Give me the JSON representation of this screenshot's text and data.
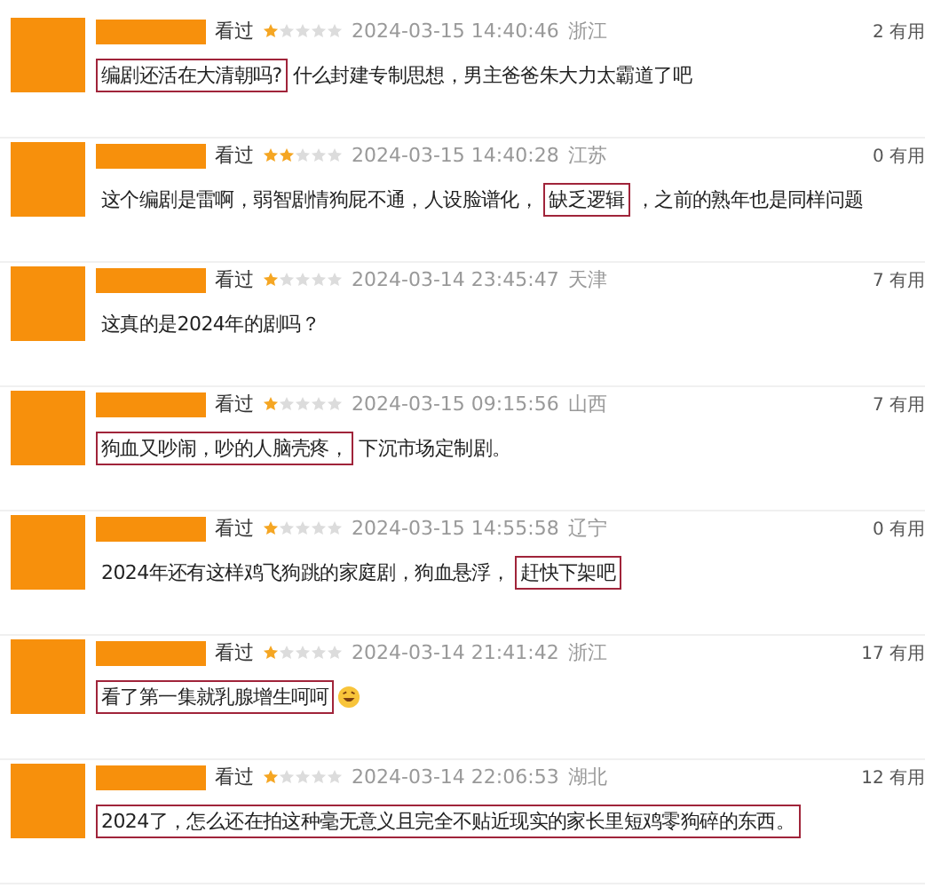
{
  "comments": [
    {
      "watched": "看过",
      "stars": 1,
      "time": "2024-03-15 14:40:46",
      "location": "浙江",
      "useful": "2 有用",
      "emoji": false,
      "text": [
        {
          "text": "编剧还活在大清朝吗?",
          "highlighted": true
        },
        {
          "text": "什么封建专制思想，男主爸爸朱大力太霸道了吧",
          "highlighted": false
        }
      ]
    },
    {
      "watched": "看过",
      "stars": 2,
      "time": "2024-03-15 14:40:28",
      "location": "江苏",
      "useful": "0 有用",
      "emoji": false,
      "text": [
        {
          "text": "这个编剧是雷啊，弱智剧情狗屁不通，人设脸谱化，",
          "highlighted": false
        },
        {
          "text": "缺乏逻辑",
          "highlighted": true
        },
        {
          "text": "，之前的熟年也是同样问题",
          "highlighted": false
        }
      ]
    },
    {
      "watched": "看过",
      "stars": 1,
      "time": "2024-03-14 23:45:47",
      "location": "天津",
      "useful": "7 有用",
      "emoji": false,
      "text": [
        {
          "text": "这真的是2024年的剧吗？",
          "highlighted": false
        }
      ]
    },
    {
      "watched": "看过",
      "stars": 1,
      "time": "2024-03-15 09:15:56",
      "location": "山西",
      "useful": "7 有用",
      "emoji": false,
      "text": [
        {
          "text": "狗血又吵闹，吵的人脑壳疼，",
          "highlighted": true
        },
        {
          "text": "下沉市场定制剧。",
          "highlighted": false
        }
      ]
    },
    {
      "watched": "看过",
      "stars": 1,
      "time": "2024-03-15 14:55:58",
      "location": "辽宁",
      "useful": "0 有用",
      "emoji": false,
      "text": [
        {
          "text": "2024年还有这样鸡飞狗跳的家庭剧，狗血悬浮，",
          "highlighted": false
        },
        {
          "text": "赶快下架吧",
          "highlighted": true
        }
      ]
    },
    {
      "watched": "看过",
      "stars": 1,
      "time": "2024-03-14 21:41:42",
      "location": "浙江",
      "useful": "17 有用",
      "emoji": true,
      "text": [
        {
          "text": "看了第一集就乳腺增生呵呵",
          "highlighted": true
        }
      ]
    },
    {
      "watched": "看过",
      "stars": 1,
      "time": "2024-03-14 22:06:53",
      "location": "湖北",
      "useful": "12 有用",
      "emoji": false,
      "text": [
        {
          "text": "2024了，怎么还在拍这种毫无意义且完全不贴近现实的家长里短鸡零狗碎的东西。",
          "highlighted": true
        }
      ]
    }
  ]
}
